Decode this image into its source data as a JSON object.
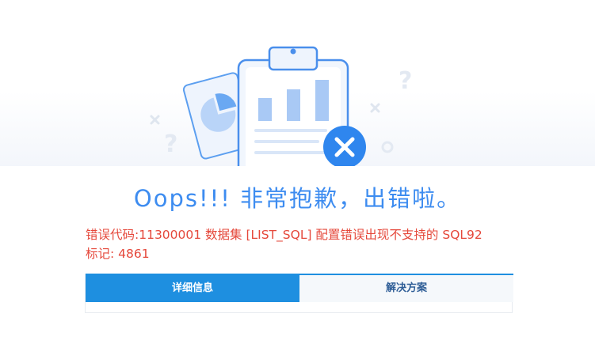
{
  "title": "Oops!!! 非常抱歉，出错啦。",
  "error": {
    "message": "错误代码:11300001 数据集 [LIST_SQL] 配置错误出现不支持的 SQL92",
    "mark": "标记: 4861"
  },
  "tabs": [
    {
      "label": "详细信息",
      "active": true
    },
    {
      "label": "解决方案",
      "active": false
    }
  ],
  "colors": {
    "title": "#3d8cf0",
    "error_text": "#e5483b",
    "tab_active_bg": "#1e8fe0",
    "tab_inactive_text": "#2f5e97"
  },
  "illustration": {
    "icons": [
      "report-chart-icon",
      "close-badge-icon",
      "question-mark-icon"
    ]
  }
}
